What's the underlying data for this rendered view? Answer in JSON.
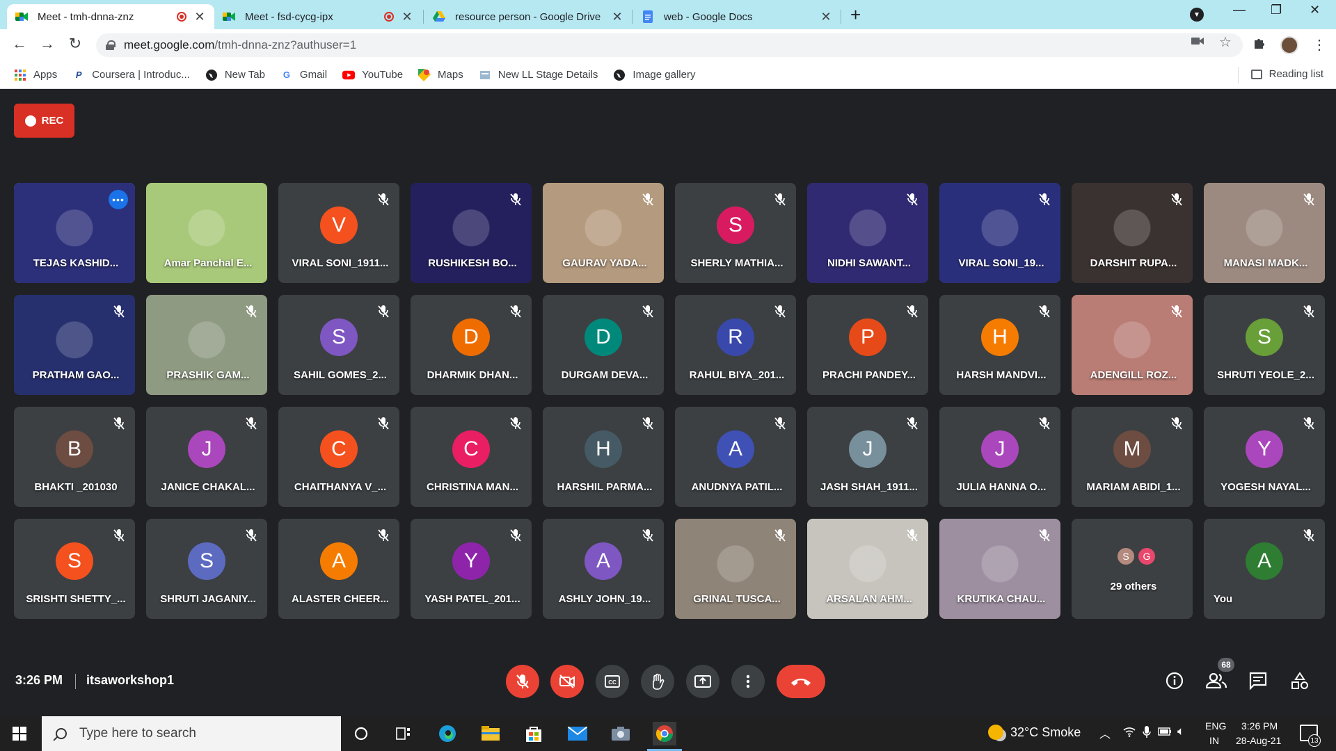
{
  "browser": {
    "tabs": [
      {
        "title": "Meet - tmh-dnna-znz",
        "active": true,
        "recording": true,
        "icon": "meet-icon"
      },
      {
        "title": "Meet - fsd-cycg-ipx",
        "active": false,
        "recording": true,
        "icon": "meet-icon"
      },
      {
        "title": "resource person - Google Drive",
        "active": false,
        "recording": false,
        "icon": "drive-icon"
      },
      {
        "title": "web - Google Docs",
        "active": false,
        "recording": false,
        "icon": "docs-icon"
      }
    ],
    "new_tab_symbol": "+",
    "url_host": "meet.google.com",
    "url_path": "/tmh-dnna-znz?authuser=1",
    "bookmarks": [
      {
        "label": "Apps",
        "icon": "apps-grid-icon"
      },
      {
        "label": "Coursera | Introduc...",
        "icon": "coursera-icon"
      },
      {
        "label": "New Tab",
        "icon": "globe-icon"
      },
      {
        "label": "Gmail",
        "icon": "google-icon"
      },
      {
        "label": "YouTube",
        "icon": "youtube-icon"
      },
      {
        "label": "Maps",
        "icon": "maps-icon"
      },
      {
        "label": "New LL Stage Details",
        "icon": "page-icon"
      },
      {
        "label": "Image gallery",
        "icon": "globe-icon"
      }
    ],
    "reading_list": "Reading list"
  },
  "meet": {
    "rec_label": "REC",
    "participants": [
      {
        "name": "TEJAS KASHID...",
        "type": "video",
        "speaking": true,
        "bg": "#2c2f7a",
        "more_menu": true
      },
      {
        "name": "Amar Panchal E...",
        "type": "video",
        "bg": "#a9c97a",
        "mic_off": false
      },
      {
        "name": "VIRAL SONI_1911...",
        "type": "avatar",
        "initial": "V",
        "color": "#f4511e"
      },
      {
        "name": "RUSHIKESH BO...",
        "type": "video",
        "bg": "#24205e"
      },
      {
        "name": "GAURAV YADA...",
        "type": "video",
        "bg": "#b49a7e"
      },
      {
        "name": "SHERLY MATHIA...",
        "type": "avatar",
        "initial": "S",
        "color": "#d81b60"
      },
      {
        "name": "NIDHI SAWANT...",
        "type": "video",
        "bg": "#302a73"
      },
      {
        "name": "VIRAL SONI_19...",
        "type": "video",
        "bg": "#2a2f7c"
      },
      {
        "name": "DARSHIT RUPA...",
        "type": "video",
        "bg": "#3a3230"
      },
      {
        "name": "MANASI MADK...",
        "type": "video",
        "bg": "#9c8a80"
      },
      {
        "name": "PRATHAM GAO...",
        "type": "video",
        "bg": "#27306e"
      },
      {
        "name": "PRASHIK GAM...",
        "type": "video",
        "bg": "#8f9a82"
      },
      {
        "name": "SAHIL GOMES_2...",
        "type": "avatar",
        "initial": "S",
        "color": "#7e57c2"
      },
      {
        "name": "DHARMIK DHAN...",
        "type": "avatar",
        "initial": "D",
        "color": "#ef6c00"
      },
      {
        "name": "DURGAM DEVA...",
        "type": "avatar",
        "initial": "D",
        "color": "#00897b"
      },
      {
        "name": "RAHUL BIYA_201...",
        "type": "avatar",
        "initial": "R",
        "color": "#3949ab"
      },
      {
        "name": "PRACHI PANDEY...",
        "type": "avatar",
        "initial": "P",
        "color": "#e64a19"
      },
      {
        "name": "HARSH MANDVI...",
        "type": "avatar",
        "initial": "H",
        "color": "#f57c00"
      },
      {
        "name": "ADENGILL ROZ...",
        "type": "video",
        "bg": "#b97d75"
      },
      {
        "name": "SHRUTI YEOLE_2...",
        "type": "avatar",
        "initial": "S",
        "color": "#689f38"
      },
      {
        "name": "BHAKTI _201030",
        "type": "avatar",
        "initial": "B",
        "color": "#6d4c41"
      },
      {
        "name": "JANICE CHAKAL...",
        "type": "avatar",
        "initial": "J",
        "color": "#ab47bc"
      },
      {
        "name": "CHAITHANYA V_...",
        "type": "avatar",
        "initial": "C",
        "color": "#f4511e"
      },
      {
        "name": "CHRISTINA MAN...",
        "type": "avatar",
        "initial": "C",
        "color": "#e91e63"
      },
      {
        "name": "HARSHIL PARMA...",
        "type": "avatar",
        "initial": "H",
        "color": "#455a64"
      },
      {
        "name": "ANUDNYA PATIL...",
        "type": "avatar",
        "initial": "A",
        "color": "#3f51b5"
      },
      {
        "name": "JASH SHAH_1911...",
        "type": "avatar",
        "initial": "J",
        "color": "#78909c"
      },
      {
        "name": "JULIA HANNA O...",
        "type": "avatar",
        "initial": "J",
        "color": "#ab47bc"
      },
      {
        "name": "MARIAM ABIDI_1...",
        "type": "avatar",
        "initial": "M",
        "color": "#6d4c41"
      },
      {
        "name": "YOGESH NAYAL...",
        "type": "avatar",
        "initial": "Y",
        "color": "#ab47bc"
      },
      {
        "name": "SRISHTI SHETTY_...",
        "type": "avatar",
        "initial": "S",
        "color": "#f4511e"
      },
      {
        "name": "SHRUTI JAGANIY...",
        "type": "avatar",
        "initial": "S",
        "color": "#5c6bc0"
      },
      {
        "name": "ALASTER CHEER...",
        "type": "avatar",
        "initial": "A",
        "color": "#f57c00"
      },
      {
        "name": "YASH PATEL_201...",
        "type": "avatar",
        "initial": "Y",
        "color": "#8e24aa"
      },
      {
        "name": "ASHLY JOHN_19...",
        "type": "avatar",
        "initial": "A",
        "color": "#7e57c2"
      },
      {
        "name": "GRINAL TUSCA...",
        "type": "video",
        "bg": "#8f8478"
      },
      {
        "name": "ARSALAN AHM...",
        "type": "video",
        "bg": "#c7c4bd"
      },
      {
        "name": "KRUTIKA CHAU...",
        "type": "video",
        "bg": "#9d8fa0"
      },
      {
        "name": "29 others",
        "type": "others",
        "mini": [
          {
            "initial": "S",
            "color": "#b58a7e"
          },
          {
            "initial": "G",
            "color": "#e8486d"
          }
        ]
      },
      {
        "name": "You",
        "type": "avatar",
        "initial": "A",
        "color": "#2e7d32",
        "self": true
      }
    ],
    "time": "3:26 PM",
    "meeting_code": "itsaworkshop1",
    "people_count": "68"
  },
  "taskbar": {
    "search_placeholder": "Type here to search",
    "weather": "32°C  Smoke",
    "lang_top": "ENG",
    "lang_bottom": "IN",
    "clock_time": "3:26 PM",
    "clock_date": "28-Aug-21",
    "notification_count": "13"
  }
}
